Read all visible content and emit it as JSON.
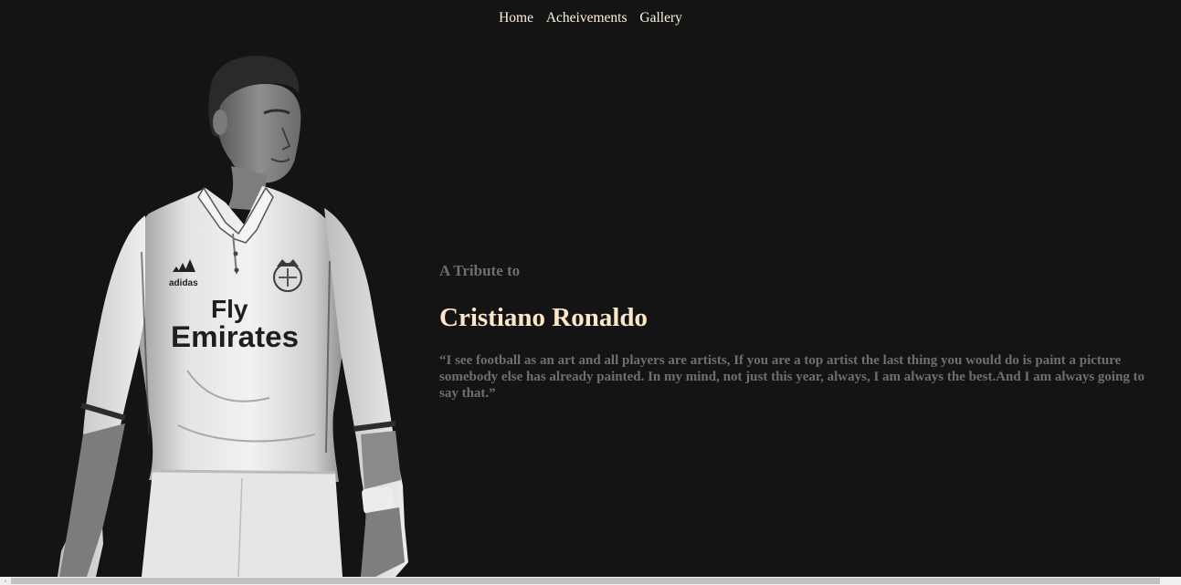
{
  "nav": {
    "items": [
      {
        "label": "Home"
      },
      {
        "label": "Acheivements"
      },
      {
        "label": "Gallery"
      }
    ]
  },
  "hero": {
    "subtitle": "A Tribute to",
    "title": "Cristiano Ronaldo",
    "quote": "“I see football as an art and all players are artists, If you are a top artist the last thing you would do is paint a picture somebody else has already painted. In my mind, not just this year, always, I am always the best.And I am always going to say that.”"
  },
  "photo": {
    "sponsor_line1": "Fly",
    "sponsor_line2": "Emirates",
    "brand": "adidas"
  },
  "colors": {
    "background": "#141414",
    "nav_text": "#fdf2dd",
    "title": "#fde6c9",
    "muted_text": "#6f6f6f"
  }
}
